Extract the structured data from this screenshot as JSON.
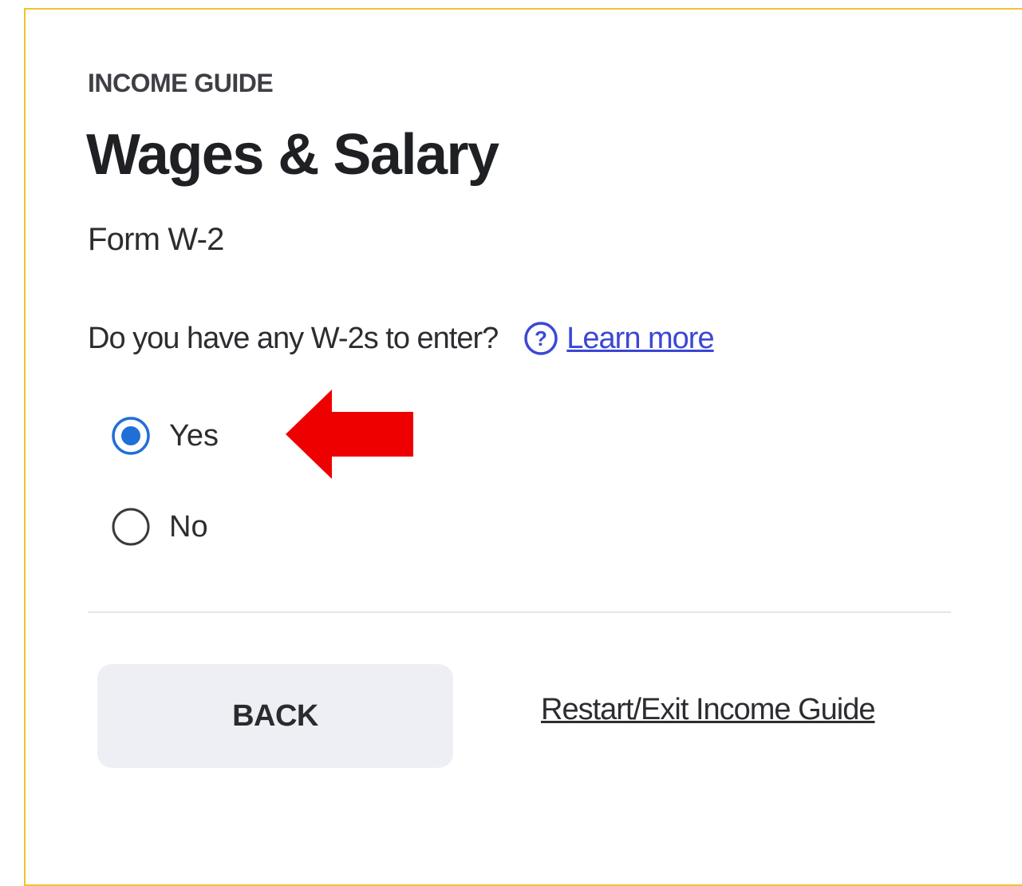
{
  "header": {
    "eyebrow": "INCOME GUIDE",
    "title": "Wages & Salary",
    "subtitle": "Form W-2"
  },
  "question": {
    "text": "Do you have any W-2s to enter?",
    "help_icon": "question-circle-icon",
    "learn_more_label": "Learn more"
  },
  "options": [
    {
      "label": "Yes",
      "selected": true
    },
    {
      "label": "No",
      "selected": false
    }
  ],
  "actions": {
    "back_label": "BACK",
    "restart_label": "Restart/Exit Income Guide"
  },
  "annotation": {
    "icon": "red-arrow-left-icon"
  },
  "colors": {
    "frame_border": "#f2c230",
    "link_blue": "#3b47d4",
    "radio_selected": "#1f6fd8",
    "arrow_red": "#ee0000",
    "back_button_bg": "#eeeff4"
  }
}
